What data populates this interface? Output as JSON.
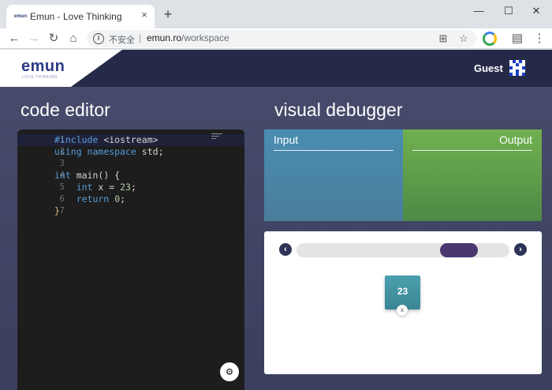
{
  "browser": {
    "tab_title": "Emun - Love Thinking",
    "tab_favicon_text": "emun",
    "tab_close": "×",
    "new_tab": "+",
    "minimize": "—",
    "maximize": "☐",
    "close": "✕",
    "omnibox": {
      "security_label": "不安全",
      "separator": "|",
      "host": "emun.ro",
      "path": "/workspace"
    }
  },
  "header": {
    "logo": "emun",
    "logo_tagline": "LOVE THINKING",
    "user_label": "Guest"
  },
  "editor": {
    "title": "code editor",
    "lines": [
      {
        "num": "1"
      },
      {
        "num": "2"
      },
      {
        "num": "3"
      },
      {
        "num": "4"
      },
      {
        "num": "5"
      },
      {
        "num": "6"
      },
      {
        "num": "7"
      }
    ],
    "tokens": {
      "l1_pp": "#include",
      "l1_rest": " <iostream>",
      "l2_kw1": "using",
      "l2_kw2": " namespace",
      "l2_rest": " std;",
      "l4_kw": "int",
      "l4_rest": " main() {",
      "l5_kw": "    int",
      "l5_mid": " x = ",
      "l5_num": "23",
      "l5_end": ";",
      "l6_kw": "    return",
      "l6_sp": " ",
      "l6_num": "0",
      "l6_end": ";",
      "l7_brace": "}"
    },
    "settings_icon": "gear-icon"
  },
  "debugger": {
    "title": "visual debugger",
    "input_label": "Input",
    "output_label": "Output",
    "prev_glyph": "‹",
    "next_glyph": "›",
    "step_progress": 0.82,
    "variable": {
      "value": "23",
      "name": "x"
    }
  },
  "colors": {
    "header_bg": "#252a48",
    "workspace_bg": "#474b6b",
    "input_bg": "#4a8db2",
    "output_bg": "#70b050",
    "slider_thumb": "#4a3770",
    "variable_box": "#4b9fae"
  }
}
